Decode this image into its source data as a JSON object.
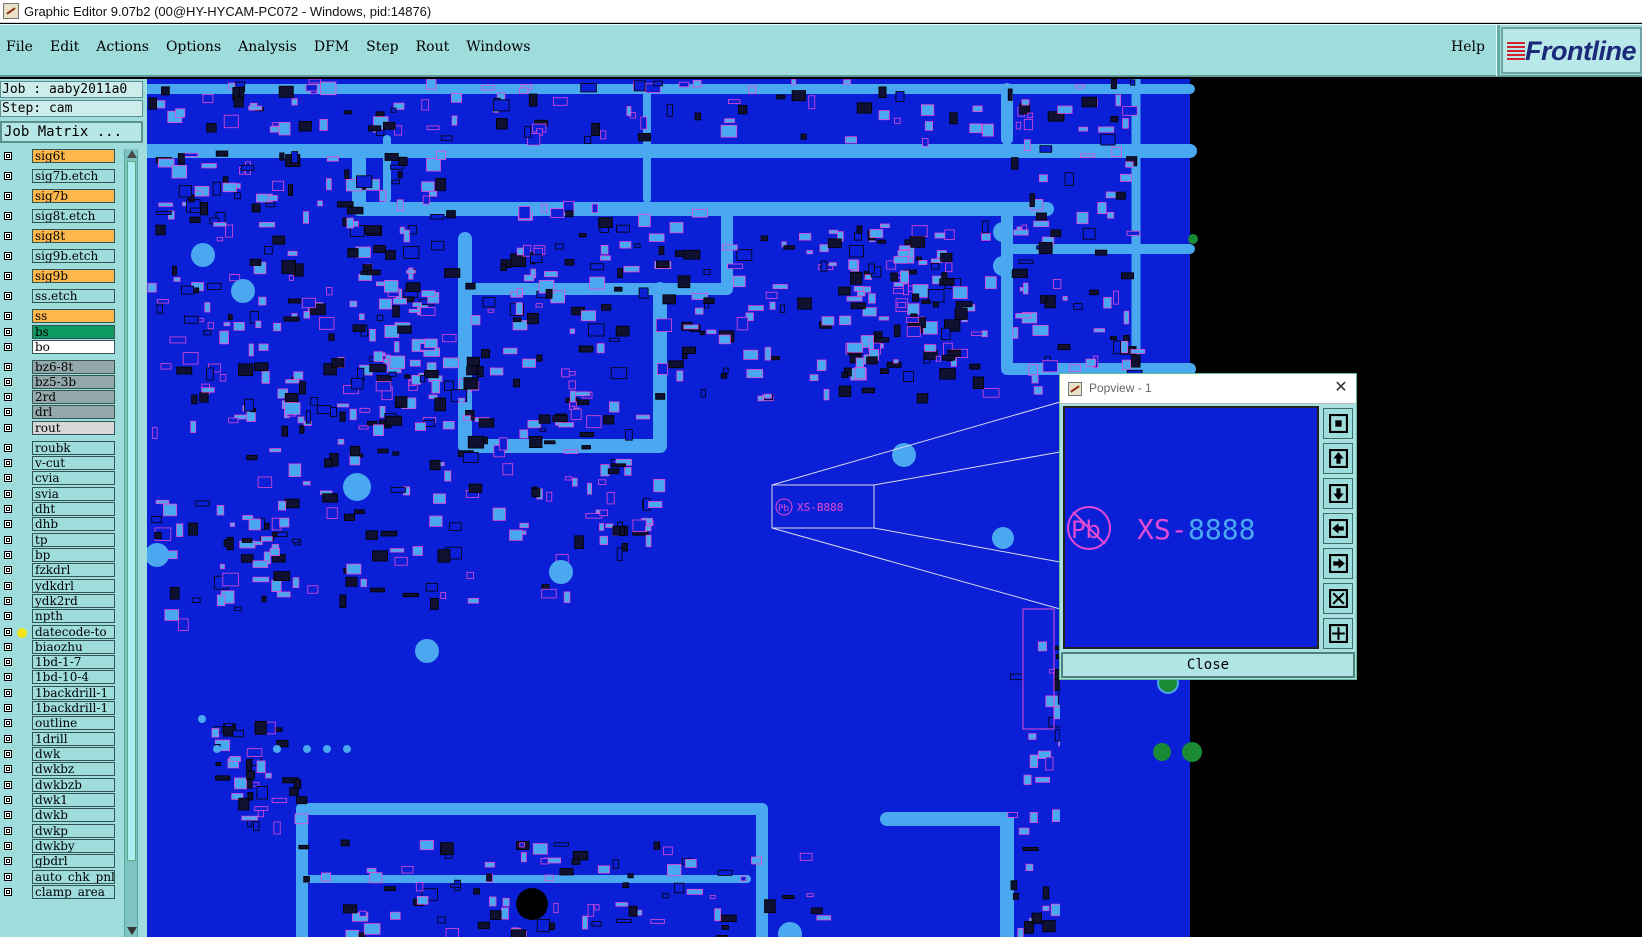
{
  "window": {
    "title": "Graphic Editor 9.07b2 (00@HY-HYCAM-PC072 - Windows, pid:14876)"
  },
  "menu": {
    "items": [
      "File",
      "Edit",
      "Actions",
      "Options",
      "Analysis",
      "DFM",
      "Step",
      "Rout",
      "Windows"
    ],
    "help": "Help",
    "logo": "Frontline"
  },
  "job": {
    "job_line": "Job : aaby2011a0",
    "step_line": "Step: cam",
    "matrix_button": "Job Matrix ..."
  },
  "layers": [
    {
      "name": "sig6t",
      "color": "#ffb84d"
    },
    {
      "name": "sig7b.etch",
      "color": "#9fdcdc"
    },
    {
      "name": "sig7b",
      "color": "#ffb84d"
    },
    {
      "name": "sig8t.etch",
      "color": "#9fdcdc"
    },
    {
      "name": "sig8t",
      "color": "#ffb84d"
    },
    {
      "name": "sig9b.etch",
      "color": "#9fdcdc"
    },
    {
      "name": "sig9b",
      "color": "#ffb84d"
    },
    {
      "name": "ss.etch",
      "color": "#9fdcdc"
    },
    {
      "name": "ss",
      "color": "#ffb84d"
    },
    {
      "name": "bs",
      "color": "#0f9a64"
    },
    {
      "name": "bo",
      "color": "#ffffff"
    },
    {
      "name": "bz6-8t",
      "color": "#93a8aa"
    },
    {
      "name": "bz5-3b",
      "color": "#93a8aa"
    },
    {
      "name": "2rd",
      "color": "#93a8aa"
    },
    {
      "name": "drl",
      "color": "#93a8aa"
    },
    {
      "name": "rout",
      "color": "#d8d8d8"
    },
    {
      "name": "roubk",
      "color": "#9fdcdc"
    },
    {
      "name": "v-cut",
      "color": "#9fdcdc"
    },
    {
      "name": "cvia",
      "color": "#9fdcdc"
    },
    {
      "name": "svia",
      "color": "#9fdcdc"
    },
    {
      "name": "dht",
      "color": "#9fdcdc"
    },
    {
      "name": "dhb",
      "color": "#9fdcdc"
    },
    {
      "name": "tp",
      "color": "#9fdcdc"
    },
    {
      "name": "bp",
      "color": "#9fdcdc"
    },
    {
      "name": "fzkdrl",
      "color": "#9fdcdc"
    },
    {
      "name": "ydkdrl",
      "color": "#9fdcdc"
    },
    {
      "name": "ydk2rd",
      "color": "#9fdcdc"
    },
    {
      "name": "npth",
      "color": "#9fdcdc"
    },
    {
      "name": "datecode-to",
      "color": "#9fdcdc",
      "marked": true
    },
    {
      "name": "biaozhu",
      "color": "#9fdcdc"
    },
    {
      "name": "1bd-1-7",
      "color": "#9fdcdc"
    },
    {
      "name": "1bd-10-4",
      "color": "#9fdcdc"
    },
    {
      "name": "1backdrill-1",
      "color": "#9fdcdc"
    },
    {
      "name": "1backdrill-1",
      "color": "#9fdcdc"
    },
    {
      "name": "outline",
      "color": "#9fdcdc"
    },
    {
      "name": "1drill",
      "color": "#9fdcdc"
    },
    {
      "name": "dwk",
      "color": "#9fdcdc"
    },
    {
      "name": "dwkbz",
      "color": "#9fdcdc"
    },
    {
      "name": "dwkbzb",
      "color": "#9fdcdc"
    },
    {
      "name": "dwk1",
      "color": "#9fdcdc"
    },
    {
      "name": "dwkb",
      "color": "#9fdcdc"
    },
    {
      "name": "dwkp",
      "color": "#9fdcdc"
    },
    {
      "name": "dwkby",
      "color": "#9fdcdc"
    },
    {
      "name": "gbdrl",
      "color": "#9fdcdc"
    },
    {
      "name": "auto_chk_pnl",
      "color": "#9fdcdc"
    },
    {
      "name": "clamp_area",
      "color": "#9fdcdc"
    }
  ],
  "canvas": {
    "board_label": "XS-B888",
    "pb_mark": "Pb",
    "colors": {
      "substrate": "#0b1fd6",
      "plane": "#4aa8f0",
      "pad": "#e24ad6"
    }
  },
  "popview": {
    "title": "Popview - 1",
    "close_x": "✕",
    "pb_text": "Pb",
    "label_prefix": "XS-",
    "label_suffix": "8888",
    "close_button": "Close",
    "tools": [
      "zoom-fit-icon",
      "arrow-up-icon",
      "arrow-down-icon",
      "arrow-left-icon",
      "arrow-right-icon",
      "zoom-out-icon",
      "pan-icon"
    ]
  }
}
